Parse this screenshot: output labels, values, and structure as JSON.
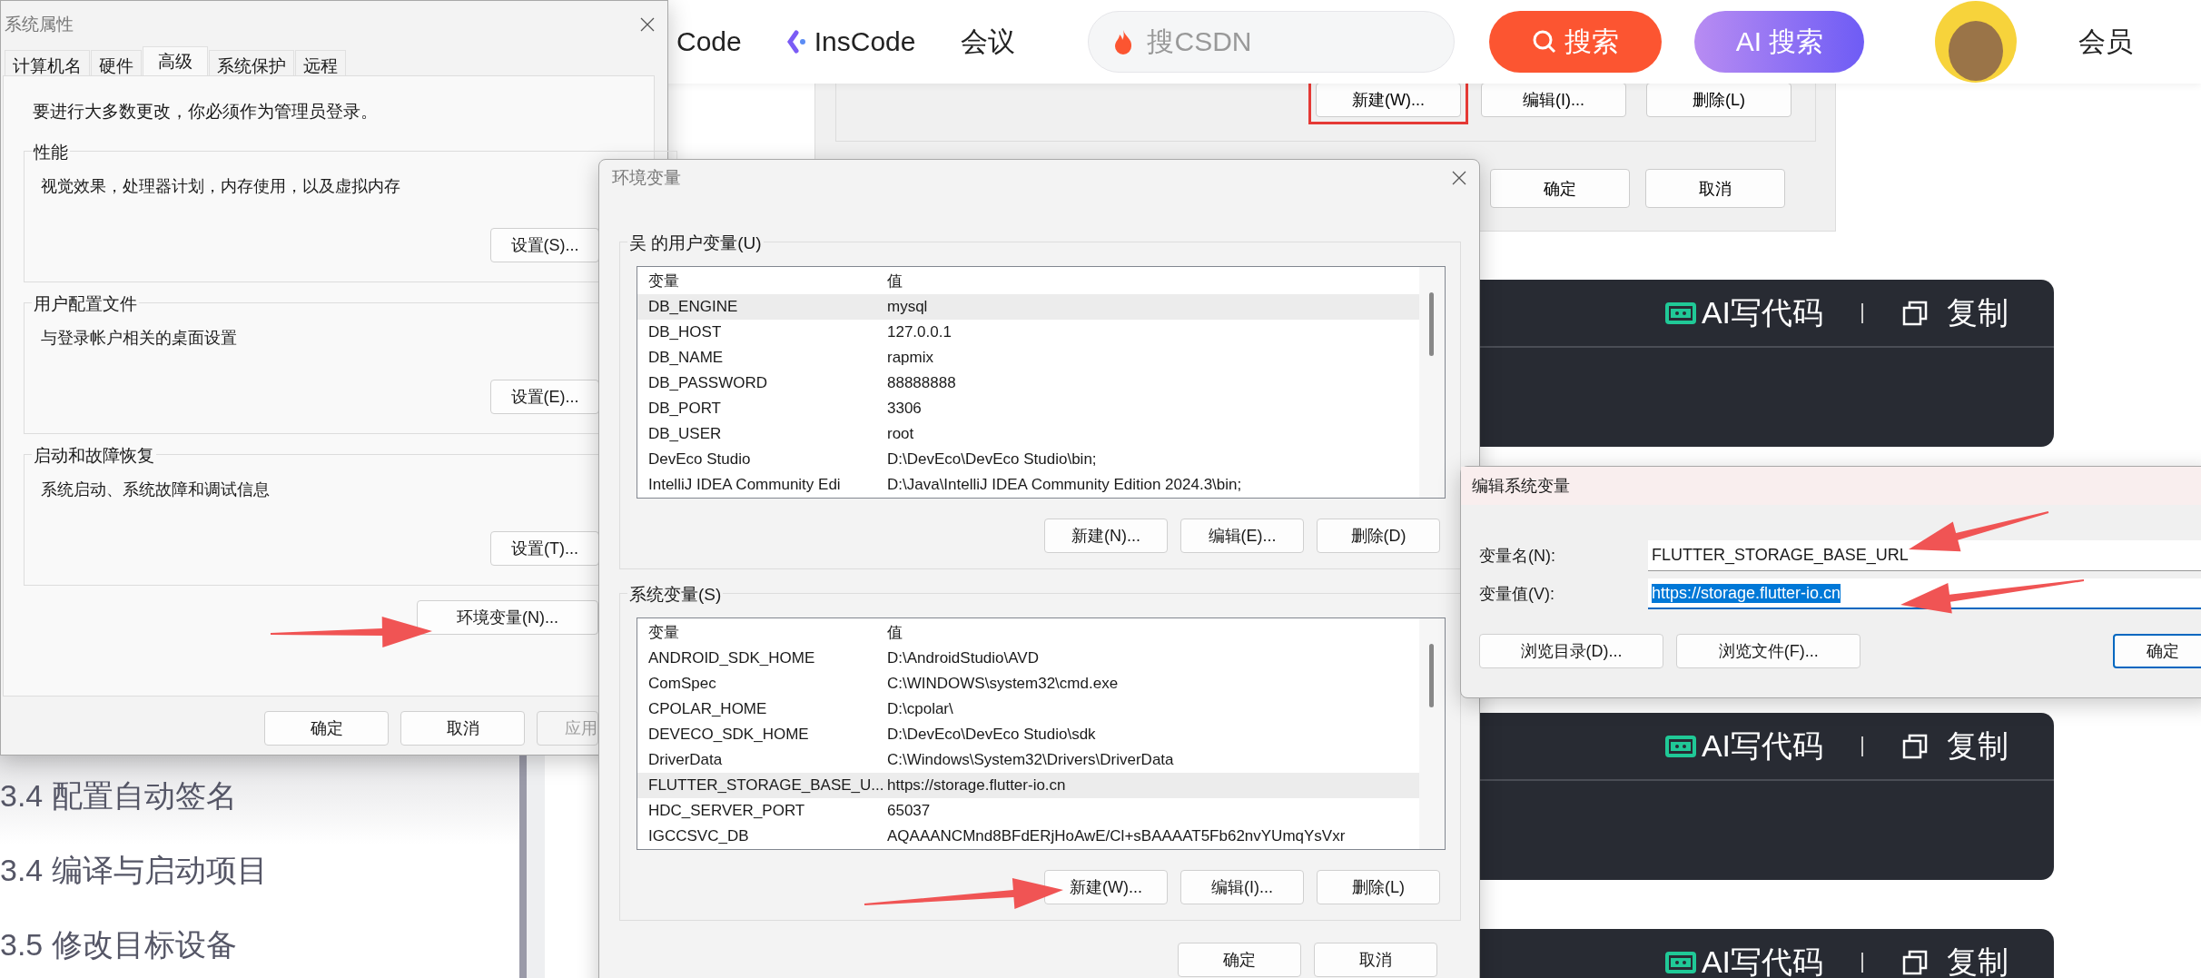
{
  "web_page": {
    "nav": {
      "items": [
        "Code",
        "InsCode",
        "会议"
      ],
      "search": {
        "placeholder": "搜CSDN"
      },
      "search_button": "搜索",
      "ai_search_button": "AI 搜索",
      "member_link": "会员"
    },
    "article_image": {
      "buttons": [
        {
          "label": "新建(W)...",
          "highlighted": true
        },
        {
          "label": "编辑(I)...",
          "highlighted": false
        },
        {
          "label": "删除(L)",
          "highlighted": false
        }
      ],
      "dialog_buttons": [
        "确定",
        "取消"
      ]
    },
    "toc": {
      "items": [
        "3.4 配置自动签名",
        "3.4 编译与启动项目",
        "3.5 修改目标设备"
      ]
    },
    "code_blocks": [
      {
        "ai_label": "AI写代码",
        "copy_label": "复制"
      },
      {
        "ai_label": "AI写代码",
        "copy_label": "复制"
      },
      {
        "ai_label": "AI写代码",
        "copy_label": "复制"
      }
    ]
  },
  "system_properties": {
    "title": "系统属性",
    "tabs": [
      {
        "label": "计算机名",
        "selected": false
      },
      {
        "label": "硬件",
        "selected": false
      },
      {
        "label": "高级",
        "selected": true
      },
      {
        "label": "系统保护",
        "selected": false
      },
      {
        "label": "远程",
        "selected": false
      }
    ],
    "notice": "要进行大多数更改，你必须作为管理员登录。",
    "groups": [
      {
        "title": "性能",
        "description": "视觉效果，处理器计划，内存使用，以及虚拟内存",
        "button": "设置(S)..."
      },
      {
        "title": "用户配置文件",
        "description": "与登录帐户相关的桌面设置",
        "button": "设置(E)..."
      },
      {
        "title": "启动和故障恢复",
        "description": "系统启动、系统故障和调试信息",
        "button": "设置(T)..."
      }
    ],
    "env_button": "环境变量(N)...",
    "buttons": [
      {
        "label": "确定",
        "disabled": false
      },
      {
        "label": "取消",
        "disabled": false
      },
      {
        "label": "应用",
        "disabled": true
      }
    ]
  },
  "environment_variables": {
    "title": "环境变量",
    "user_vars": {
      "title": "吴 的用户变量(U)",
      "columns": [
        "变量",
        "值"
      ],
      "rows": [
        {
          "name": "DB_ENGINE",
          "value": "mysql",
          "selected": true
        },
        {
          "name": "DB_HOST",
          "value": "127.0.0.1",
          "selected": false
        },
        {
          "name": "DB_NAME",
          "value": "rapmix",
          "selected": false
        },
        {
          "name": "DB_PASSWORD",
          "value": "88888888",
          "selected": false
        },
        {
          "name": "DB_PORT",
          "value": "3306",
          "selected": false
        },
        {
          "name": "DB_USER",
          "value": "root",
          "selected": false
        },
        {
          "name": "DevEco Studio",
          "value": "D:\\DevEco\\DevEco Studio\\bin;",
          "selected": false
        },
        {
          "name": "IntelliJ IDEA Community Edi",
          "value": "D:\\Java\\IntelliJ IDEA Community Edition 2024.3\\bin;",
          "selected": false
        }
      ],
      "buttons": [
        "新建(N)...",
        "编辑(E)...",
        "删除(D)"
      ]
    },
    "system_vars": {
      "title": "系统变量(S)",
      "columns": [
        "变量",
        "值"
      ],
      "rows": [
        {
          "name": "ANDROID_SDK_HOME",
          "value": "D:\\AndroidStudio\\AVD",
          "selected": false
        },
        {
          "name": "ComSpec",
          "value": "C:\\WINDOWS\\system32\\cmd.exe",
          "selected": false
        },
        {
          "name": "CPOLAR_HOME",
          "value": "D:\\cpolar\\",
          "selected": false
        },
        {
          "name": "DEVECO_SDK_HOME",
          "value": "D:\\DevEco\\DevEco Studio\\sdk",
          "selected": false
        },
        {
          "name": "DriverData",
          "value": "C:\\Windows\\System32\\Drivers\\DriverData",
          "selected": false
        },
        {
          "name": "FLUTTER_STORAGE_BASE_U...",
          "value": "https://storage.flutter-io.cn",
          "selected": true
        },
        {
          "name": "HDC_SERVER_PORT",
          "value": "65037",
          "selected": false
        },
        {
          "name": "IGCCSVC_DB",
          "value": "AQAAANCMnd8BFdERjHoAwE/Cl+sBAAAAT5Fb62nvYUmqYsVxr",
          "selected": false
        }
      ],
      "buttons": [
        "新建(W)...",
        "编辑(I)...",
        "删除(L)"
      ]
    },
    "buttons": [
      "确定",
      "取消"
    ]
  },
  "edit_dialog": {
    "title": "编辑系统变量",
    "name_label": "变量名(N):",
    "name_value": "FLUTTER_STORAGE_BASE_URL",
    "value_label": "变量值(V):",
    "value_value": "https://storage.flutter-io.cn",
    "buttons": [
      {
        "label": "浏览目录(D)...",
        "default": false
      },
      {
        "label": "浏览文件(F)...",
        "default": false
      },
      {
        "label": "确定",
        "default": true
      }
    ]
  }
}
